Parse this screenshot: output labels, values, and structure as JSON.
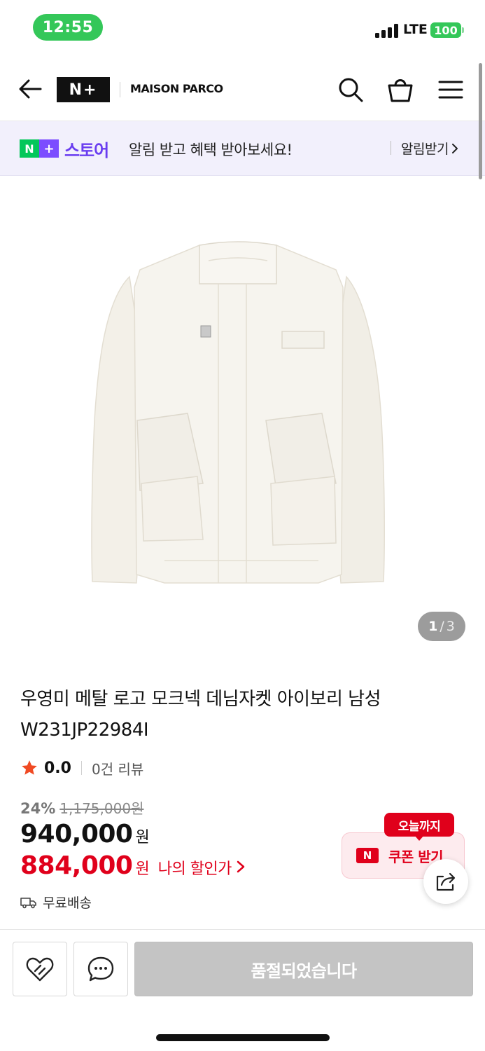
{
  "status_bar": {
    "time": "12:55",
    "network": "LTE",
    "battery": "100"
  },
  "header": {
    "logo_text": "N+",
    "brand": "MAISON PARCO",
    "icons": [
      "back-arrow-icon",
      "search-icon",
      "shopping-bag-icon",
      "menu-icon"
    ]
  },
  "notice": {
    "store_logo_n": "N",
    "store_logo_plus": "+",
    "store_word": "스토어",
    "message": "알림 받고 혜택 받아보세요!",
    "action_label": "알림받기"
  },
  "gallery": {
    "current": "1",
    "separator": "/",
    "total": "3"
  },
  "product": {
    "title": "우영미 메탈 로고 모크넥 데님자켓 아이보리 남성 W231JP22984I",
    "rating": "0.0",
    "review_count": "0건 리뷰",
    "discount_rate": "24%",
    "original_price": "1,175,000원",
    "price": "940,000",
    "currency": "원",
    "my_price": "884,000",
    "my_currency": "원",
    "my_price_label": "나의 할인가",
    "shipping": "무료배송"
  },
  "coupon": {
    "badge": "오늘까지",
    "icon_text": "N",
    "label": "쿠폰 받기"
  },
  "bottom_bar": {
    "soldout_label": "품절되었습니다"
  },
  "colors": {
    "accent_red": "#e0001b",
    "naver_green": "#03c75a",
    "store_purple": "#7c4dff",
    "notice_bg": "#f2f0fc",
    "status_green": "#34c759"
  }
}
